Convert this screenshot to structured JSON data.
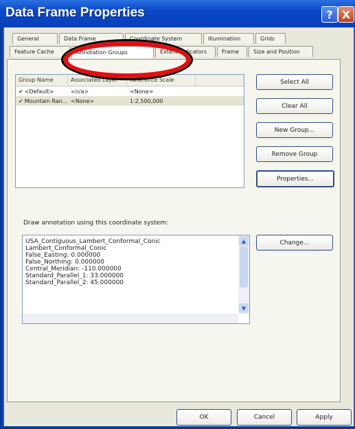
{
  "window": {
    "title": "Data Frame Properties",
    "help_label": "?",
    "close_label": "X"
  },
  "tabs": {
    "row1": [
      "General",
      "Data Frame",
      "Coordinate System",
      "Illumination",
      "Grids"
    ],
    "row2": [
      "Feature Cache",
      "Annotation Groups",
      "Extent Indicators",
      "Frame",
      "Size and Position"
    ],
    "active": "Annotation Groups"
  },
  "groups": {
    "columns": [
      "Group Name",
      "Associated Layer",
      "Reference Scale"
    ],
    "rows": [
      {
        "name": "<Default>",
        "layer": "<n/a>",
        "scale": "<None>",
        "checked": true
      },
      {
        "name": "Mountain Ran...",
        "layer": "<None>",
        "scale": "1:2,500,000",
        "checked": true
      }
    ]
  },
  "buttons": {
    "select_all": "Select All",
    "clear_all": "Clear All",
    "new_group": "New Group...",
    "remove_group": "Remove Group",
    "properties": "Properties...",
    "change": "Change...",
    "ok": "OK",
    "cancel": "Cancel",
    "apply": "Apply"
  },
  "coord": {
    "label": "Draw annotation using this coordinate system:",
    "lines": [
      "USA_Contiguous_Lambert_Conformal_Conic",
      "Lambert_Conformal_Conic",
      "False_Easting: 0.000000",
      "False_Northing: 0.000000",
      "Central_Meridian: -110.000000",
      "Standard_Parallel_1: 33.000000",
      "Standard_Parallel_2: 45.000000"
    ]
  },
  "colors": {
    "highlight_circle": "#e01010",
    "titlebar": "#0a48c8"
  }
}
